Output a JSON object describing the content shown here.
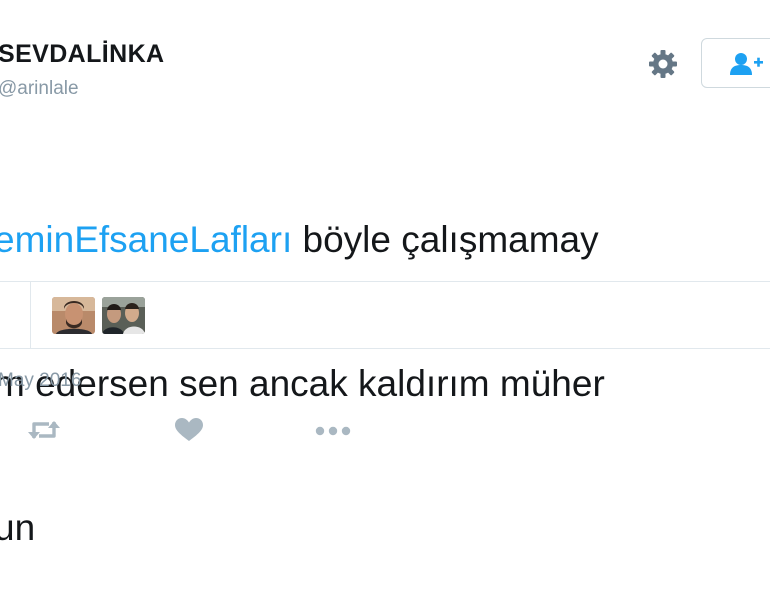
{
  "user": {
    "display_name": "SEVDALİNKA",
    "handle": "@arinlale"
  },
  "tweet": {
    "line1_hashtag": "eminEfsaneLafları",
    "line1_rest": " böyle çalışmamay",
    "line2": "m edersen sen ancak kaldırım müher",
    "line3": "un",
    "date": "May 2016"
  },
  "icons": {
    "settings": "gear-icon",
    "follow": "add-user-icon",
    "retweet": "retweet-icon",
    "like": "heart-icon",
    "more": "more-dots-icon"
  },
  "colors": {
    "hashtag": "#1da1f2",
    "muted": "#8899a6",
    "follow_icon": "#1da1f2",
    "divider": "#e1e8ed"
  }
}
